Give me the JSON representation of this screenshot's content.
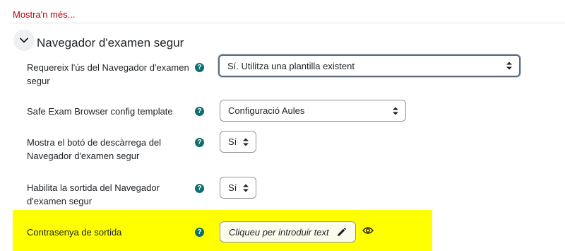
{
  "show_more_link": "Mostra'n més...",
  "section": {
    "title": "Navegador d'examen segur",
    "toggle_icon": "chevron-down-icon"
  },
  "fields": {
    "require_seb": {
      "label_line1": "Requereix l'ús del Navegador d'examen",
      "label_line2": "segur",
      "help": "?",
      "value": "Sí. Utilitza una plantilla existent"
    },
    "config_template": {
      "label": "Safe Exam Browser config template",
      "help": "?",
      "value": "Configuració Aules"
    },
    "show_download": {
      "label_line1": "Mostra el botó de descàrrega del",
      "label_line2": "Navegador d'examen segur",
      "help": "?",
      "value": "Sí"
    },
    "allow_quit": {
      "label_line1": "Habilita la sortida del Navegador",
      "label_line2": "d'examen segur",
      "help": "?",
      "value": "Sí"
    },
    "quit_password": {
      "label": "Contrasenya de sortida",
      "help": "?",
      "placeholder": "Cliqueu per introduir text",
      "edit_icon": "pencil-icon",
      "reveal_icon": "eye-icon"
    }
  },
  "colors": {
    "link": "#b5000b",
    "help_icon": "#0f6e6e",
    "highlight": "#ffff00"
  }
}
